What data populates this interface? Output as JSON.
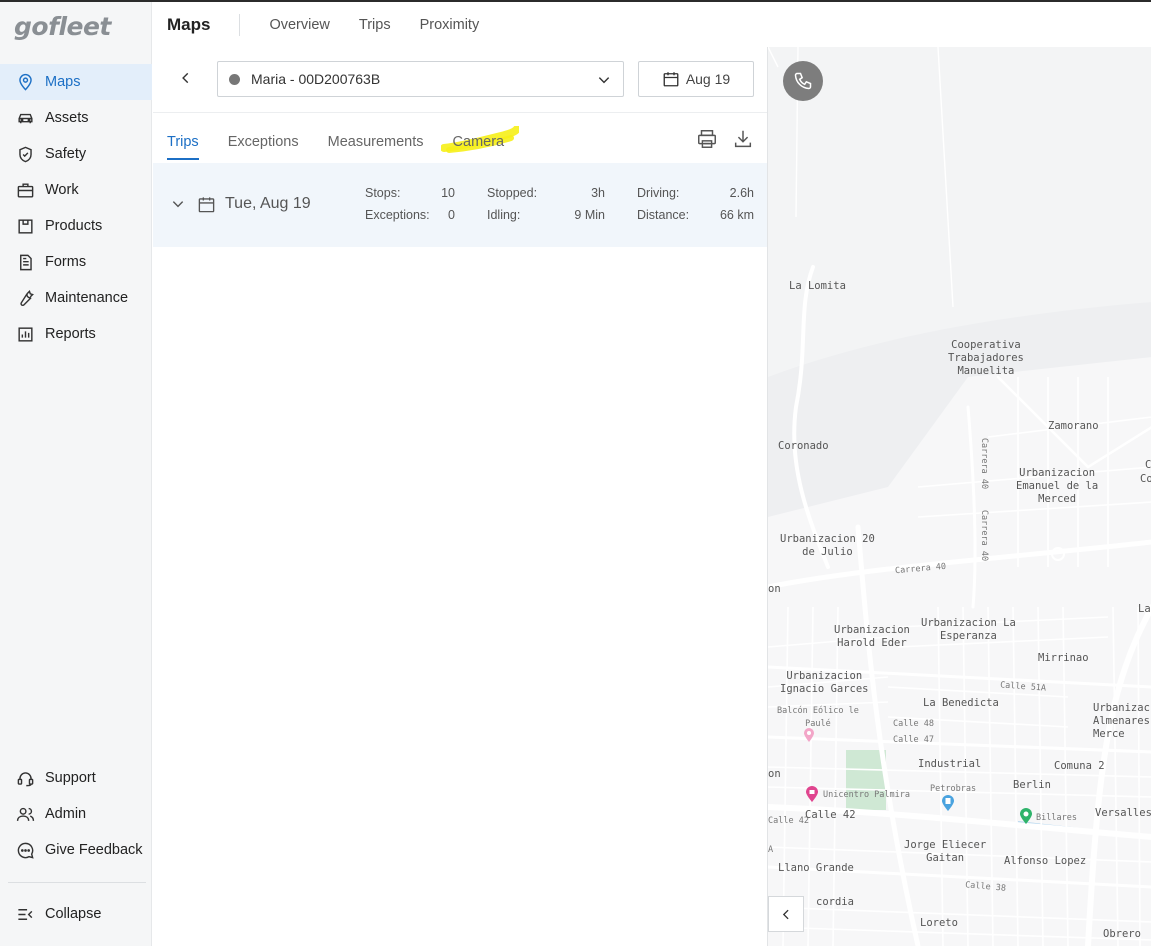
{
  "brand": {
    "logo_text": "gofleet"
  },
  "header": {
    "title": "Maps",
    "links": [
      "Overview",
      "Trips",
      "Proximity"
    ]
  },
  "sidebar": {
    "items": [
      {
        "label": "Maps",
        "icon": "map-pin-icon",
        "active": true
      },
      {
        "label": "Assets",
        "icon": "car-icon"
      },
      {
        "label": "Safety",
        "icon": "shield-icon"
      },
      {
        "label": "Work",
        "icon": "briefcase-icon"
      },
      {
        "label": "Products",
        "icon": "box-icon"
      },
      {
        "label": "Forms",
        "icon": "document-icon"
      },
      {
        "label": "Maintenance",
        "icon": "wrench-icon"
      },
      {
        "label": "Reports",
        "icon": "bar-chart-icon"
      }
    ],
    "bottom_items": [
      {
        "label": "Support",
        "icon": "headset-icon"
      },
      {
        "label": "Admin",
        "icon": "users-icon"
      },
      {
        "label": "Give Feedback",
        "icon": "chat-icon"
      }
    ],
    "collapse_label": "Collapse"
  },
  "panel": {
    "device": "Maria - 00D200763B",
    "date": "Aug 19",
    "tabs": [
      "Trips",
      "Exceptions",
      "Measurements",
      "Camera"
    ],
    "active_tab": "Trips",
    "highlight_color": "#f6f018",
    "day": {
      "label": "Tue, Aug 19",
      "stops_label": "Stops:",
      "stops": "10",
      "exceptions_label": "Exceptions:",
      "exceptions": "0",
      "stopped_label": "Stopped:",
      "stopped": "3h",
      "idling_label": "Idling:",
      "idling": "9 Min",
      "driving_label": "Driving:",
      "driving": "2.6h",
      "distance_label": "Distance:",
      "distance": "66 km"
    }
  },
  "map": {
    "labels": {
      "la_lomita": "La Lomita",
      "cooperativa": "Cooperativa\nTrabajadores\nManuelita",
      "zamorano": "Zamorano",
      "coronado": "Coronado",
      "carrera40a": "Carrera 40",
      "carrera40b": "Carrera 40",
      "carrera40c": "Carrera 40",
      "emanuel": "Urbanizacion\nEmanuel de la\nMerced",
      "julio": "Urbanizacion 20\nde Julio",
      "esperanza": "Urbanizacion La\nEsperanza",
      "harold": "Urbanizacion\nHarold Eder",
      "mirrinao": "Mirrinao",
      "calle51a": "Calle 51A",
      "ignacio": "Urbanizacion\nIgnacio Garces",
      "balcon": "Balcón Eólico le\nPaulé",
      "benedicta": "La Benedicta",
      "almenares": "Urbanizac\nAlmenares\nMerce",
      "calle48": "Calle 48",
      "calle47": "Calle 47",
      "industrial": "Industrial",
      "comuna2": "Comuna 2",
      "unicentro": "Unicentro Palmira",
      "petrobras": "Petrobras",
      "berlin": "Berlin",
      "calle42a": "Calle 42",
      "calle42b": "Calle 42",
      "billares": "Billares",
      "versalles": "Versalles",
      "gaitan": "Jorge Eliecer\nGaitan",
      "alfonso": "Alfonso Lopez",
      "llano": "Llano Grande",
      "calle38": "Calle 38",
      "concordia": "cordia",
      "loreto": "Loreto",
      "obrero": "Obrero",
      "edge_on1": "on",
      "edge_on2": "on",
      "edge_a": "A",
      "edge_c1": "C",
      "edge_c2": "Co",
      "edge_la": "La"
    },
    "colors": {
      "park": "#cfe8d4",
      "water": "#b9d8ef"
    }
  }
}
